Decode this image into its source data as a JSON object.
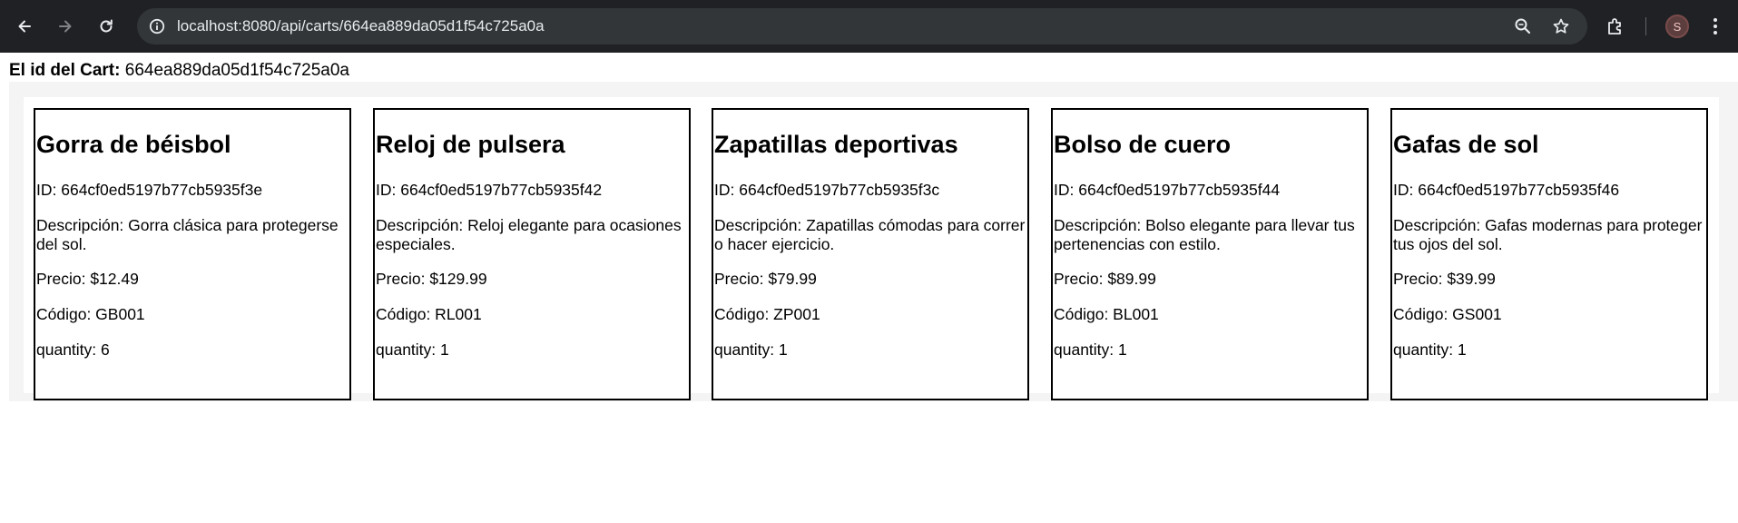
{
  "browser": {
    "url": "localhost:8080/api/carts/664ea889da05d1f54c725a0a",
    "profile_initial": "S",
    "icons": [
      "back-arrow-icon",
      "forward-arrow-icon",
      "reload-icon",
      "site-info-icon",
      "zoom-icon",
      "bookmark-star-icon",
      "extensions-icon",
      "menu-dots-icon"
    ]
  },
  "page": {
    "cart_label": "El id del Cart:",
    "cart_id": "664ea889da05d1f54c725a0a"
  },
  "products": [
    {
      "title": "Gorra de béisbol",
      "id_line": "ID: 664cf0ed5197b77cb5935f3e",
      "desc_line": "Descripción: Gorra clásica para protegerse del sol.",
      "price_line": "Precio: $12.49",
      "code_line": "Código: GB001",
      "quantity_line": "quantity: 6"
    },
    {
      "title": "Reloj de pulsera",
      "id_line": "ID: 664cf0ed5197b77cb5935f42",
      "desc_line": "Descripción: Reloj elegante para ocasiones especiales.",
      "price_line": "Precio: $129.99",
      "code_line": "Código: RL001",
      "quantity_line": "quantity: 1"
    },
    {
      "title": "Zapatillas deportivas",
      "id_line": "ID: 664cf0ed5197b77cb5935f3c",
      "desc_line": "Descripción: Zapatillas cómodas para correr o hacer ejercicio.",
      "price_line": "Precio: $79.99",
      "code_line": "Código: ZP001",
      "quantity_line": "quantity: 1"
    },
    {
      "title": "Bolso de cuero",
      "id_line": "ID: 664cf0ed5197b77cb5935f44",
      "desc_line": "Descripción: Bolso elegante para llevar tus pertenencias con estilo.",
      "price_line": "Precio: $89.99",
      "code_line": "Código: BL001",
      "quantity_line": "quantity: 1"
    },
    {
      "title": "Gafas de sol",
      "id_line": "ID: 664cf0ed5197b77cb5935f46",
      "desc_line": "Descripción: Gafas modernas para proteger tus ojos del sol.",
      "price_line": "Precio: $39.99",
      "code_line": "Código: GS001",
      "quantity_line": "quantity: 1"
    }
  ]
}
